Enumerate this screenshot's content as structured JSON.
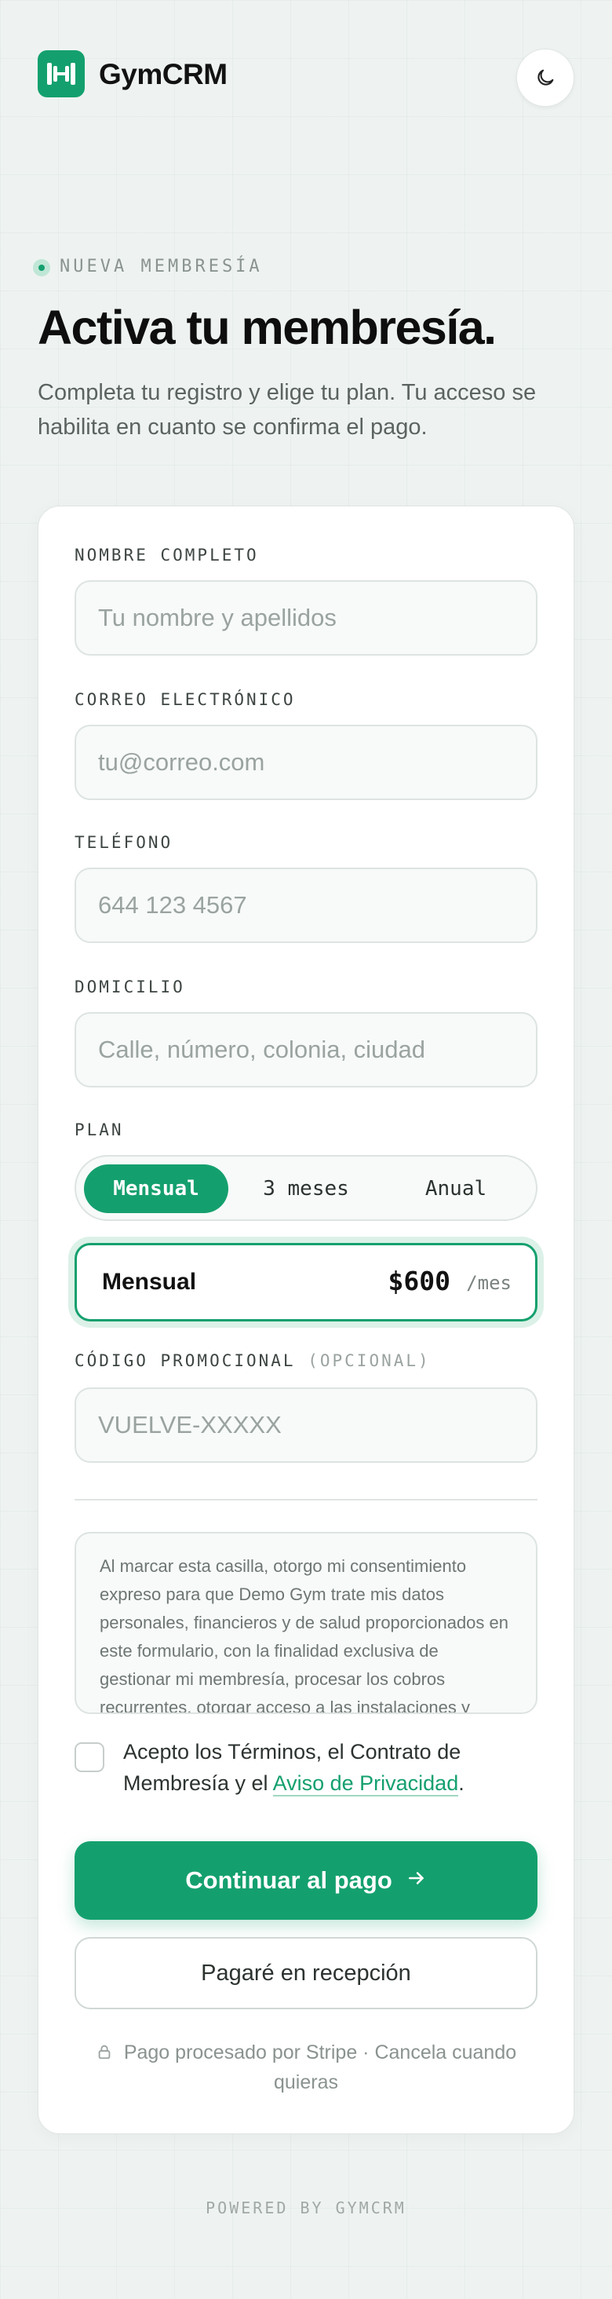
{
  "header": {
    "brand": "GymCRM",
    "logo_icon": "barbell-icon",
    "theme_toggle_icon": "moon-icon"
  },
  "hero": {
    "eyebrow": "NUEVA MEMBRESÍA",
    "title": "Activa tu membresía.",
    "subtitle": "Completa tu registro y elige tu plan. Tu acceso se habilita en cuanto se confirma el pago."
  },
  "form": {
    "name": {
      "label": "NOMBRE COMPLETO",
      "placeholder": "Tu nombre y apellidos"
    },
    "email": {
      "label": "CORREO ELECTRÓNICO",
      "placeholder": "tu@correo.com"
    },
    "phone": {
      "label": "TELÉFONO",
      "placeholder": "644 123 4567"
    },
    "address": {
      "label": "DOMICILIO",
      "placeholder": "Calle, número, colonia, ciudad"
    },
    "plan": {
      "label": "PLAN",
      "options": [
        "Mensual",
        "3 meses",
        "Anual"
      ],
      "selected": "Mensual",
      "summary_name": "Mensual",
      "summary_price": "$600",
      "summary_period": "/mes"
    },
    "promo": {
      "label": "CÓDIGO PROMOCIONAL",
      "label_optional": "(OPCIONAL)",
      "placeholder": "VUELVE-XXXXX"
    },
    "consent_text": "Al marcar esta casilla, otorgo mi consentimiento expreso para que Demo Gym trate mis datos personales, financieros y de salud proporcionados en este formulario, con la finalidad exclusiva de gestionar mi membresía, procesar los cobros recurrentes, otorgar acceso a las instalaciones y",
    "accept_prefix": "Acepto los Términos, el Contrato de Membresía y el ",
    "accept_link": "Aviso de Privacidad",
    "accept_suffix": ".",
    "continue_label": "Continuar al pago",
    "continue_icon": "arrow-right-icon",
    "pay_reception_label": "Pagaré en recepción",
    "footnote_icon": "lock-icon",
    "footnote": "Pago procesado por Stripe · Cancela cuando quieras"
  },
  "footer": {
    "powered": "POWERED BY GYMCRM"
  },
  "colors": {
    "accent": "#14a06e",
    "background": "#eef3f1",
    "card": "#ffffff"
  }
}
